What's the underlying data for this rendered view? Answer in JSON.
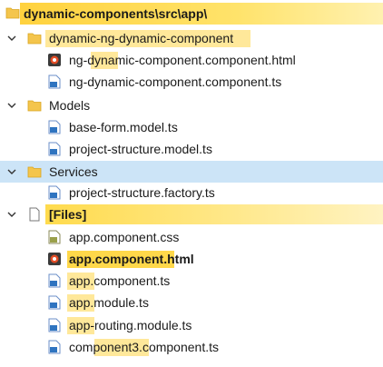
{
  "root": {
    "label": "dynamic-components\\src\\app\\"
  },
  "tree": [
    {
      "id": "folder-dynamic",
      "label": "dynamic-ng-dynamic-component"
    },
    {
      "id": "file-ng-html",
      "label": "ng-dynamic-component.component.html"
    },
    {
      "id": "file-ng-ts",
      "label": "ng-dynamic-component.component.ts"
    },
    {
      "id": "folder-models",
      "label": "Models"
    },
    {
      "id": "file-base-form",
      "label": "base-form.model.ts"
    },
    {
      "id": "file-project-structure-model",
      "label": "project-structure.model.ts"
    },
    {
      "id": "folder-services",
      "label": "Services"
    },
    {
      "id": "file-project-structure-factory",
      "label": "project-structure.factory.ts"
    },
    {
      "id": "folder-files",
      "label": "[Files]"
    },
    {
      "id": "file-app-css",
      "label": "app.component.css"
    },
    {
      "id": "file-app-html",
      "label": "app.component.html"
    },
    {
      "id": "file-app-ts",
      "label": "app.component.ts"
    },
    {
      "id": "file-app-module",
      "label": "app.module.ts"
    },
    {
      "id": "file-app-routing",
      "label": "app-routing.module.ts"
    },
    {
      "id": "file-component3",
      "label": "component3.component.ts"
    }
  ],
  "colors": {
    "selection": "#cce4f7",
    "highlight": "#ffe89a",
    "folder": "#f4c54c"
  }
}
